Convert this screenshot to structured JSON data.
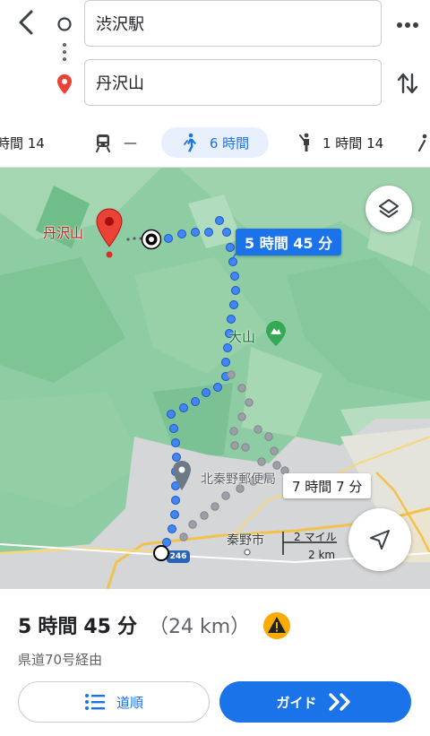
{
  "header": {
    "origin": "渋沢駅",
    "destination": "丹沢山"
  },
  "modes": [
    {
      "label": "時間 14"
    },
    {
      "label": "—"
    },
    {
      "label": "6 時間"
    },
    {
      "label": "1 時間 14"
    }
  ],
  "map": {
    "destination_label": "丹沢山",
    "main_route_label": "5 時間 45 分",
    "alt_route_label": "7 時間 7 分",
    "place_oyama": "大山",
    "place_postoffice": "北秦野郵便局",
    "place_city": "秦野市",
    "road_badge": "246",
    "scale_miles": "2 マイル",
    "scale_km": "2 km"
  },
  "summary": {
    "duration_prefix_num1": "5",
    "duration_word1": "時間",
    "duration_num2": "45",
    "duration_word2": "分",
    "distance": "（24 km）",
    "via": "県道70号経由"
  },
  "actions": {
    "steps_label": "道順",
    "guide_label": "ガイド"
  },
  "colors": {
    "accent": "#1a73e8",
    "route": "#4285f4",
    "alt_route": "#9e9e9e",
    "pin": "#ea4335",
    "warning": "#f9ab00"
  }
}
